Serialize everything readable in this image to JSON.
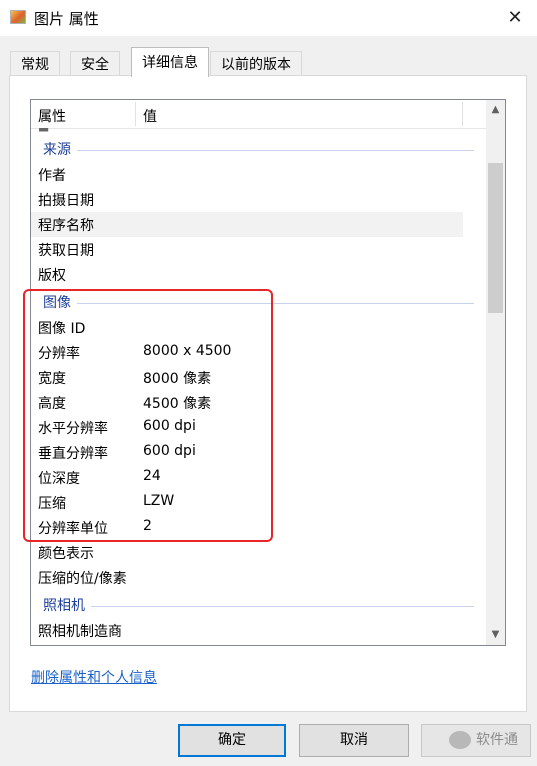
{
  "window": {
    "title": "图片 属性",
    "close_glyph": "✕"
  },
  "tabs": [
    {
      "label": "常规",
      "active": false
    },
    {
      "label": "安全",
      "active": false
    },
    {
      "label": "详细信息",
      "active": true
    },
    {
      "label": "以前的版本",
      "active": false
    }
  ],
  "list": {
    "columns": {
      "property": "属性",
      "value": "值"
    },
    "partial_top": "■",
    "groups": {
      "source": "来源",
      "image": "图像",
      "camera": "照相机"
    },
    "rows": {
      "author": {
        "name": "作者",
        "value": ""
      },
      "date_taken": {
        "name": "拍摄日期",
        "value": ""
      },
      "program_name": {
        "name": "程序名称",
        "value": ""
      },
      "date_acquired": {
        "name": "获取日期",
        "value": ""
      },
      "copyright": {
        "name": "版权",
        "value": ""
      },
      "image_id": {
        "name": "图像 ID",
        "value": ""
      },
      "dimensions": {
        "name": "分辨率",
        "value": "8000 x 4500"
      },
      "width": {
        "name": "宽度",
        "value": "8000 像素"
      },
      "height": {
        "name": "高度",
        "value": "4500 像素"
      },
      "h_resolution": {
        "name": "水平分辨率",
        "value": "600 dpi"
      },
      "v_resolution": {
        "name": "垂直分辨率",
        "value": "600 dpi"
      },
      "bit_depth": {
        "name": "位深度",
        "value": "24"
      },
      "compression": {
        "name": "压缩",
        "value": "LZW"
      },
      "resolution_unit": {
        "name": "分辨率单位",
        "value": "2"
      },
      "color_representation": {
        "name": "颜色表示",
        "value": ""
      },
      "compressed_bits": {
        "name": "压缩的位/像素",
        "value": ""
      },
      "camera_maker": {
        "name": "照相机制造商",
        "value": ""
      }
    }
  },
  "scrollbar": {
    "up_glyph": "▲",
    "down_glyph": "▼"
  },
  "remove_properties_link": "删除属性和个人信息",
  "buttons": {
    "ok": "确定",
    "cancel": "取消"
  },
  "watermark": {
    "text": "软件通"
  },
  "colors": {
    "highlight": "#e8262a",
    "group_text": "#1e3f9a",
    "link": "#1a62c7",
    "ok_border": "#0078d7"
  }
}
